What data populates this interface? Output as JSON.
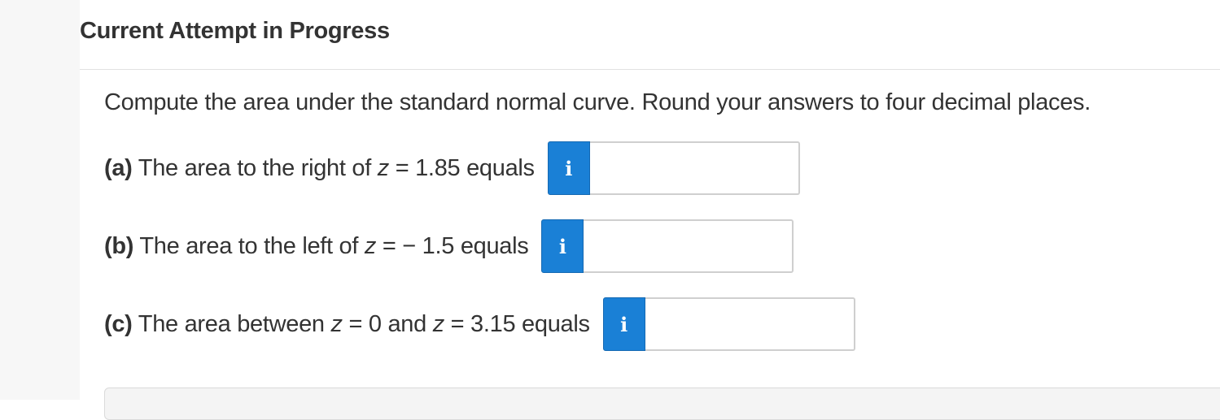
{
  "header": {
    "title": "Current Attempt in Progress"
  },
  "question": {
    "instructions": "Compute the area under the standard normal curve. Round your answers to four decimal places.",
    "parts": [
      {
        "letter": "(a)",
        "text_1": " The area to the right of ",
        "var_1": "z",
        "text_2": " = 1.85 equals",
        "var_2": "",
        "text_3": "",
        "info_label": "i",
        "answer": ""
      },
      {
        "letter": "(b)",
        "text_1": " The area to the left of ",
        "var_1": "z",
        "text_2": " = − 1.5 equals",
        "var_2": "",
        "text_3": "",
        "info_label": "i",
        "answer": ""
      },
      {
        "letter": "(c)",
        "text_1": " The area between ",
        "var_1": "z",
        "text_2": " = 0 and ",
        "var_2": "z",
        "text_3": " = 3.15 equals",
        "info_label": "i",
        "answer": ""
      }
    ]
  },
  "colors": {
    "info_button": "#1a80d6",
    "text": "#333333",
    "gutter": "#f7f7f7",
    "input_border": "#cfcfcf"
  },
  "icons": {
    "info": "info-icon"
  }
}
